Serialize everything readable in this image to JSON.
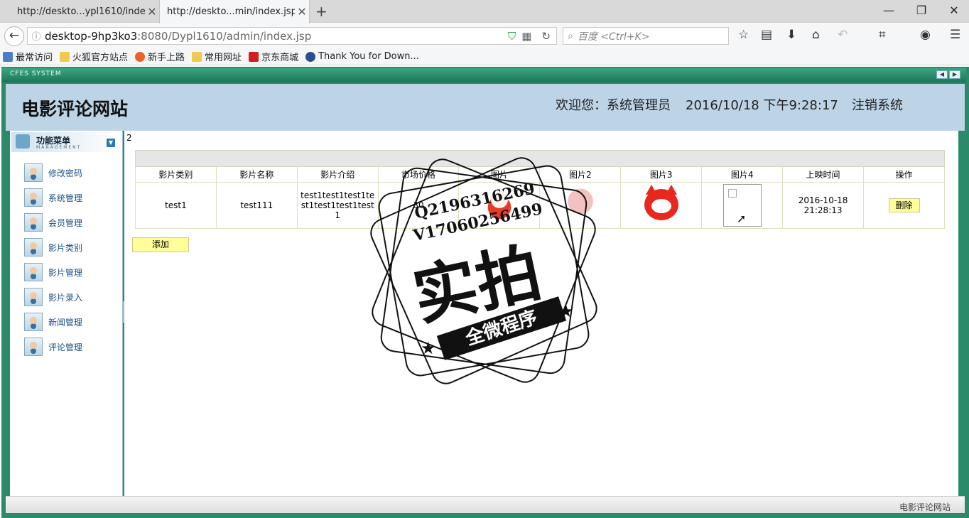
{
  "browser": {
    "tabs": [
      {
        "title": "http://deskto...ypl1610/index"
      },
      {
        "title": "http://deskto...min/index.jsp"
      }
    ],
    "url_host": "desktop-9hp3ko3",
    "url_path": ":8080/Dypl1610/admin/index.jsp",
    "search_placeholder": "百度 <Ctrl+K>",
    "bookmarks": [
      {
        "label": "最常访问",
        "color": "#4a7fc2"
      },
      {
        "label": "火狐官方站点",
        "color": "#f2c94c"
      },
      {
        "label": "新手上路",
        "color": "#e8622c"
      },
      {
        "label": "常用网址",
        "color": "#f2c94c"
      },
      {
        "label": "京东商城",
        "color": "#d11e1e"
      },
      {
        "label": "Thank You for Down...",
        "color": "#2a4d8f"
      }
    ]
  },
  "app": {
    "frame_logo": "CFES SYSTEM",
    "site_title": "电影评论网站",
    "welcome": "欢迎您：系统管理员",
    "datetime": "2016/10/18 下午9:28:17",
    "logout": "注销系统",
    "footer": "电影评论网站"
  },
  "sidebar": {
    "title": "功能菜单",
    "subtitle": "MANAGEMENT",
    "items": [
      {
        "label": "修改密码"
      },
      {
        "label": "系统管理"
      },
      {
        "label": "会员管理"
      },
      {
        "label": "影片类别"
      },
      {
        "label": "影片管理"
      },
      {
        "label": "影片录入"
      },
      {
        "label": "新闻管理"
      },
      {
        "label": "评论管理"
      }
    ]
  },
  "main": {
    "page_number": "2",
    "columns": [
      "影片类别",
      "影片名称",
      "影片介绍",
      "市场价格",
      "图片",
      "图片2",
      "图片3",
      "图片4",
      "上映时间",
      "操作"
    ],
    "rows": [
      {
        "category": "test1",
        "name": "test111",
        "intro": "test1test1test1test1test1test1test1",
        "price": "30",
        "release": "2016-10-18 21:28:13",
        "action": "删除"
      }
    ],
    "add_button": "添加"
  },
  "watermark": {
    "line1": "Q2196316269",
    "line2": "V17060256499",
    "big": "实拍",
    "band": "全微程序"
  }
}
